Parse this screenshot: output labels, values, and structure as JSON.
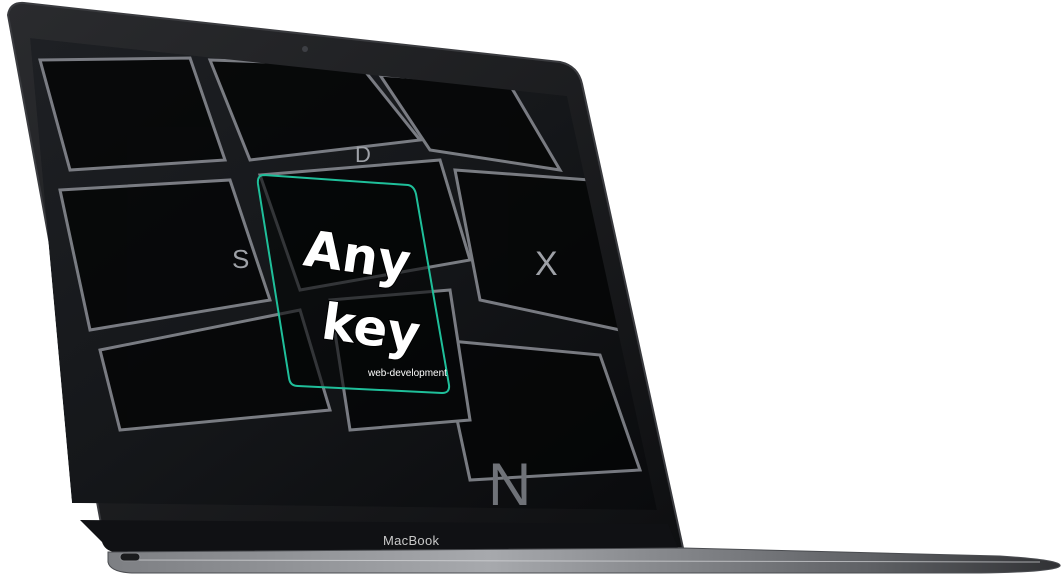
{
  "device": {
    "brand_label": "MacBook"
  },
  "screen": {
    "background": "dark keyboard photo",
    "accent_color": "#1fbf9a",
    "logo": {
      "line1": "Any",
      "line2": "key",
      "tagline": "web-development"
    }
  }
}
